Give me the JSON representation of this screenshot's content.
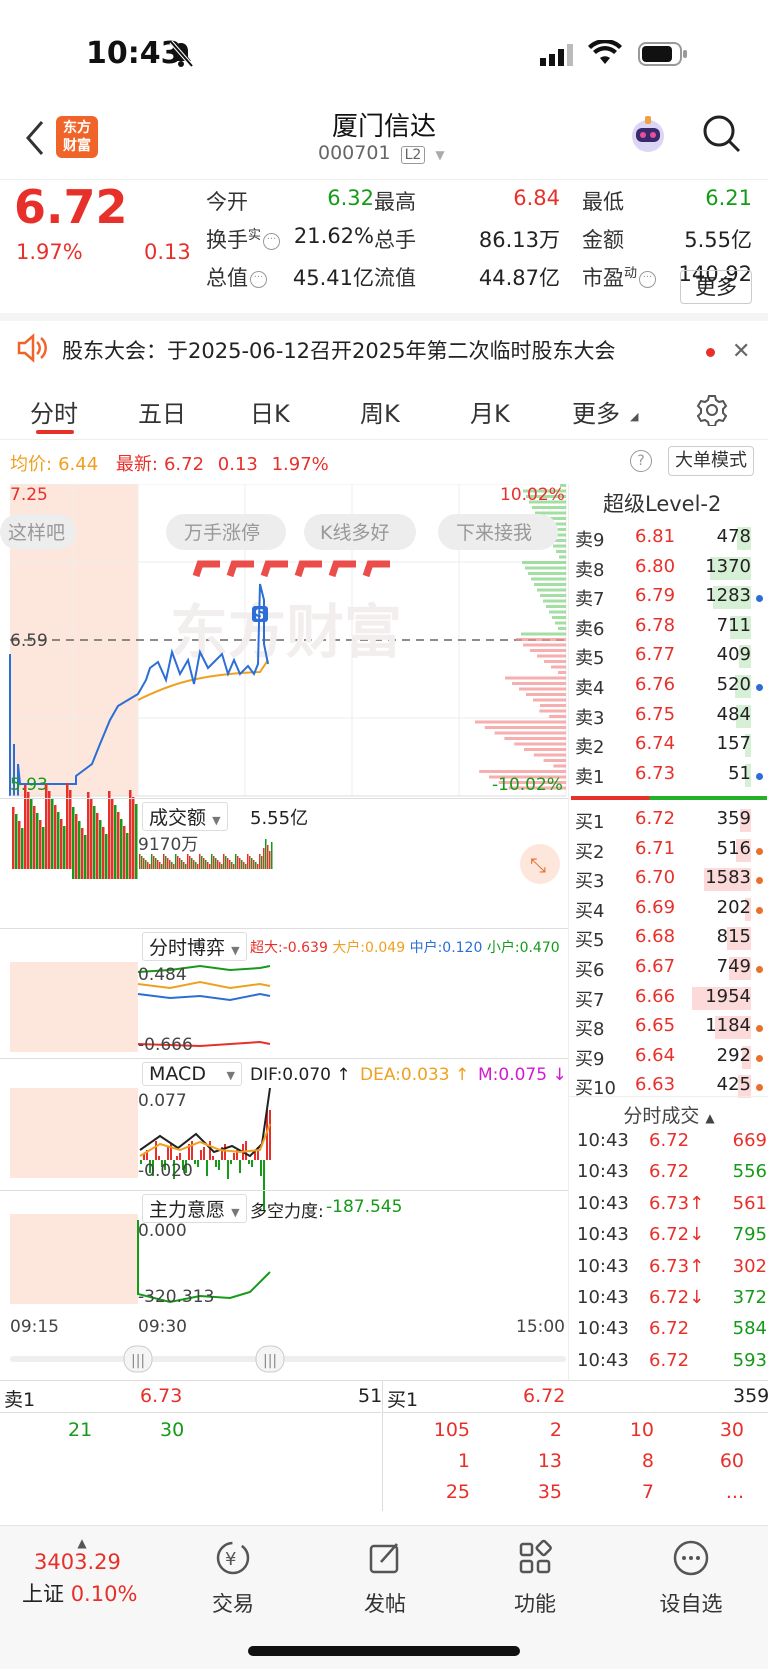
{
  "status": {
    "time": "10:43"
  },
  "header": {
    "title": "厦门信达",
    "code": "000701",
    "level": "L2",
    "logo_line1": "东方",
    "logo_line2": "财富"
  },
  "quote": {
    "price": "6.72",
    "change_pct": "1.97%",
    "change": "0.13",
    "fields": [
      {
        "label": "今开",
        "value": "6.32",
        "color": "green"
      },
      {
        "label": "最高",
        "value": "6.84",
        "color": "red"
      },
      {
        "label": "最低",
        "value": "6.21",
        "color": "green"
      },
      {
        "label": "换手",
        "sup": "实",
        "value": "21.62%",
        "color": "black"
      },
      {
        "label": "总手",
        "value": "86.13万",
        "color": "black"
      },
      {
        "label": "金额",
        "value": "5.55亿",
        "color": "black"
      },
      {
        "label": "总值",
        "value": "45.41亿",
        "color": "black"
      },
      {
        "label": "流值",
        "value": "44.87亿",
        "color": "black"
      },
      {
        "label": "市盈",
        "sup": "动",
        "value": "140.92",
        "color": "black"
      }
    ],
    "more_button": "更多"
  },
  "notice": {
    "text": "股东大会：于2025-06-12召开2025年第二次临时股东大会"
  },
  "tabs": [
    "分时",
    "五日",
    "日K",
    "周K",
    "月K",
    "更多"
  ],
  "info_bar": {
    "avg_label": "均价:",
    "avg_value": "6.44",
    "latest_label": "最新:",
    "latest_value": "6.72",
    "change": "0.13",
    "change_pct": "1.97%",
    "big_mode": "大单模式"
  },
  "main_chart": {
    "y_top": "7.25",
    "y_mid": "6.59",
    "y_bottom": "5.93",
    "pct_top": "10.02%",
    "pct_bottom": "-10.02%",
    "bubbles": [
      "这样吧",
      "万手涨停",
      "K线多好",
      "下来接我"
    ],
    "watermark": "东方财富",
    "time_labels": [
      "09:15",
      "09:30",
      "15:00"
    ]
  },
  "volume": {
    "selector": "成交额",
    "total": "5.55亿",
    "max": "9170万"
  },
  "game": {
    "selector": "分时博弈",
    "super_label": "超大:",
    "super_value": "-0.639",
    "big_label": "大户:",
    "big_value": "0.049",
    "mid_label": "中户:",
    "mid_value": "0.120",
    "small_label": "小户:",
    "small_value": "0.470",
    "top": "0.484",
    "bottom": "-0.666"
  },
  "macd": {
    "selector": "MACD",
    "dif": "DIF:0.070 ↑",
    "dea": "DEA:0.033 ↑",
    "m": "M:0.075 ↓",
    "top": "0.077",
    "bottom": "-0.020"
  },
  "will": {
    "selector": "主力意愿",
    "label": "多空力度:",
    "value": "-187.545",
    "top": "0.000",
    "bottom": "-320.313"
  },
  "level2": {
    "title": "超级Level-2",
    "sells": [
      {
        "label": "卖9",
        "price": "6.81",
        "vol": "478"
      },
      {
        "label": "卖8",
        "price": "6.80",
        "vol": "1370"
      },
      {
        "label": "卖7",
        "price": "6.79",
        "vol": "1283"
      },
      {
        "label": "卖6",
        "price": "6.78",
        "vol": "711"
      },
      {
        "label": "卖5",
        "price": "6.77",
        "vol": "409"
      },
      {
        "label": "卖4",
        "price": "6.76",
        "vol": "520"
      },
      {
        "label": "卖3",
        "price": "6.75",
        "vol": "484"
      },
      {
        "label": "卖2",
        "price": "6.74",
        "vol": "157"
      },
      {
        "label": "卖1",
        "price": "6.73",
        "vol": "51"
      }
    ],
    "buys": [
      {
        "label": "买1",
        "price": "6.72",
        "vol": "359"
      },
      {
        "label": "买2",
        "price": "6.71",
        "vol": "516"
      },
      {
        "label": "买3",
        "price": "6.70",
        "vol": "1583"
      },
      {
        "label": "买4",
        "price": "6.69",
        "vol": "202"
      },
      {
        "label": "买5",
        "price": "6.68",
        "vol": "815"
      },
      {
        "label": "买6",
        "price": "6.67",
        "vol": "749"
      },
      {
        "label": "买7",
        "price": "6.66",
        "vol": "1954"
      },
      {
        "label": "买8",
        "price": "6.65",
        "vol": "1184"
      },
      {
        "label": "买9",
        "price": "6.64",
        "vol": "292"
      },
      {
        "label": "买10",
        "price": "6.63",
        "vol": "425"
      }
    ]
  },
  "ticks": {
    "title": "分时成交",
    "rows": [
      {
        "time": "10:43",
        "price": "6.72",
        "vol": "669",
        "dir": "red"
      },
      {
        "time": "10:43",
        "price": "6.72",
        "vol": "556",
        "dir": "green"
      },
      {
        "time": "10:43",
        "price": "6.73↑",
        "vol": "561",
        "dir": "red"
      },
      {
        "time": "10:43",
        "price": "6.72↓",
        "vol": "795",
        "dir": "green"
      },
      {
        "time": "10:43",
        "price": "6.73↑",
        "vol": "302",
        "dir": "red"
      },
      {
        "time": "10:43",
        "price": "6.72↓",
        "vol": "372",
        "dir": "green"
      },
      {
        "time": "10:43",
        "price": "6.72",
        "vol": "584",
        "dir": "green"
      },
      {
        "time": "10:43",
        "price": "6.72",
        "vol": "593",
        "dir": "green"
      }
    ]
  },
  "queue": {
    "sell_label": "卖1",
    "sell_price": "6.73",
    "sell_vol": "51",
    "buy_label": "买1",
    "buy_price": "6.72",
    "buy_vol": "359",
    "sell_orders": [
      "21",
      "30"
    ],
    "buy_orders": [
      "105",
      "2",
      "10",
      "30",
      "1",
      "13",
      "8",
      "60",
      "25",
      "35",
      "7",
      "..."
    ]
  },
  "bottom": {
    "index_value": "3403.29",
    "index_name": "上证",
    "index_pct": "0.10%",
    "items": [
      "交易",
      "发帖",
      "功能",
      "设自选"
    ]
  }
}
